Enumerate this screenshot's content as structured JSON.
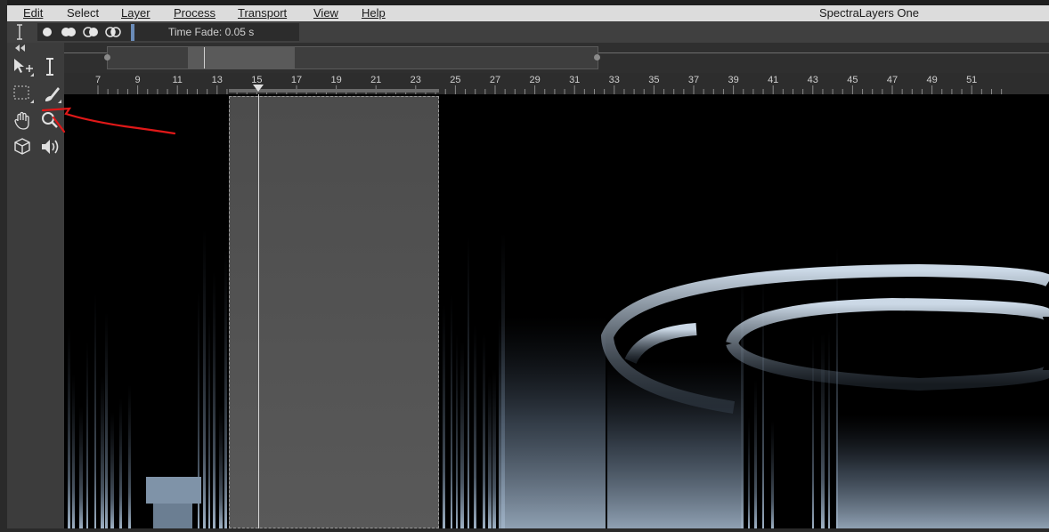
{
  "menu": {
    "items": [
      "Edit",
      "Select",
      "Layer",
      "Process",
      "Transport",
      "View",
      "Help"
    ],
    "underlined": [
      0,
      null,
      0,
      0,
      0,
      0,
      0
    ],
    "app_title": "SpectraLayers One"
  },
  "options_bar": {
    "time_fade_label": "Time Fade: 0.05 s"
  },
  "toolbar": {
    "tools": [
      "collapse-icon",
      "move-icon",
      "time-cursor-icon",
      "rectangle-select-icon",
      "brush-icon",
      "hand-icon",
      "zoom-icon",
      "cube-icon",
      "speaker-icon"
    ]
  },
  "ruler": {
    "labels": [
      "7",
      "9",
      "11",
      "13",
      "15",
      "17",
      "19",
      "21",
      "23",
      "25",
      "27",
      "29",
      "31",
      "33",
      "35",
      "37",
      "39",
      "41",
      "43",
      "45",
      "47",
      "49",
      "51"
    ]
  },
  "colors": {
    "menubar": "#dcdcdc",
    "panel": "#3c3c3c",
    "spectrogram_bg": "#000000",
    "spectrum_tint": "#9fb4c8",
    "selection": "#555555",
    "annotation": "#e01818",
    "accent": "#6a8bb8"
  }
}
